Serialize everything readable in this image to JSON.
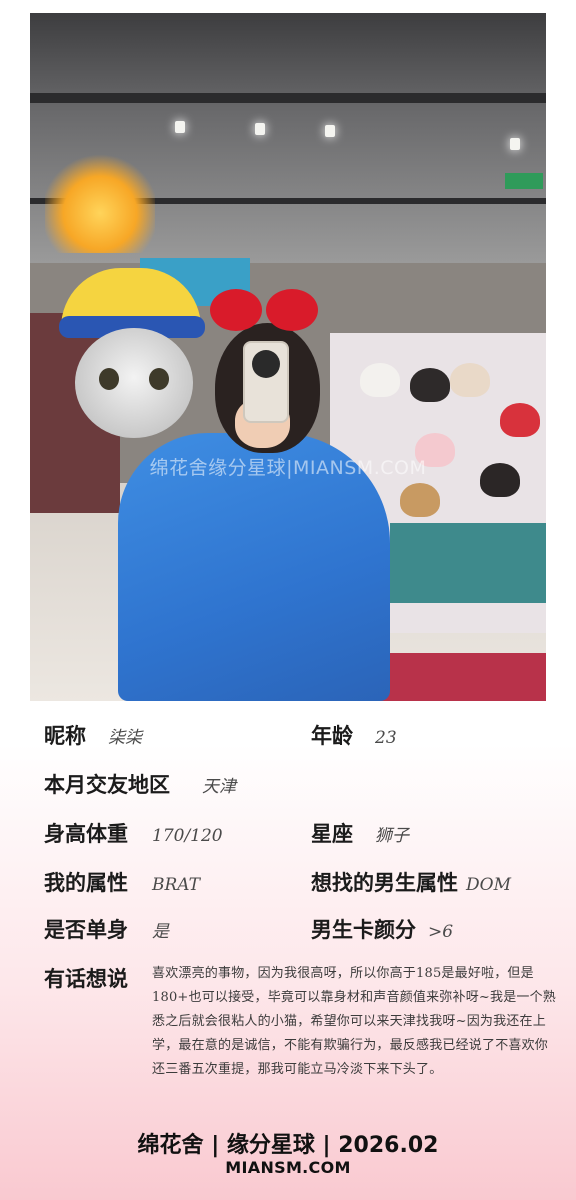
{
  "photo": {
    "watermark": "绵花舍缘分星球|MIANSM.COM"
  },
  "profile": {
    "nickname": {
      "label": "昵称",
      "value": "柒柒"
    },
    "age": {
      "label": "年龄",
      "value": "23"
    },
    "region": {
      "label": "本月交友地区",
      "value": "天津"
    },
    "height_weight": {
      "label": "身高体重",
      "value": "170/120"
    },
    "zodiac": {
      "label": "星座",
      "value": "狮子"
    },
    "my_attribute": {
      "label": "我的属性",
      "value": "BRAT"
    },
    "seeking_attribute": {
      "label": "想找的男生属性",
      "value": "DOM"
    },
    "single": {
      "label": "是否单身",
      "value": "是"
    },
    "looks_score": {
      "label": "男生卡颜分",
      "value": ">6"
    },
    "message": {
      "label": "有话想说",
      "text": "喜欢漂亮的事物，因为我很高呀，所以你高于185是最好啦，但是180+也可以接受，毕竟可以靠身材和声音颜值来弥补呀~我是一个熟悉之后就会很粘人的小猫，希望你可以来天津找我呀~因为我还在上学，最在意的是诚信，不能有欺骗行为，最反感我已经说了不喜欢你还三番五次重提，那我可能立马冷淡下来下头了。"
    }
  },
  "footer": {
    "brand": "绵花舍 | 缘分星球 | 2026.02",
    "site": "MIANSM.COM"
  }
}
